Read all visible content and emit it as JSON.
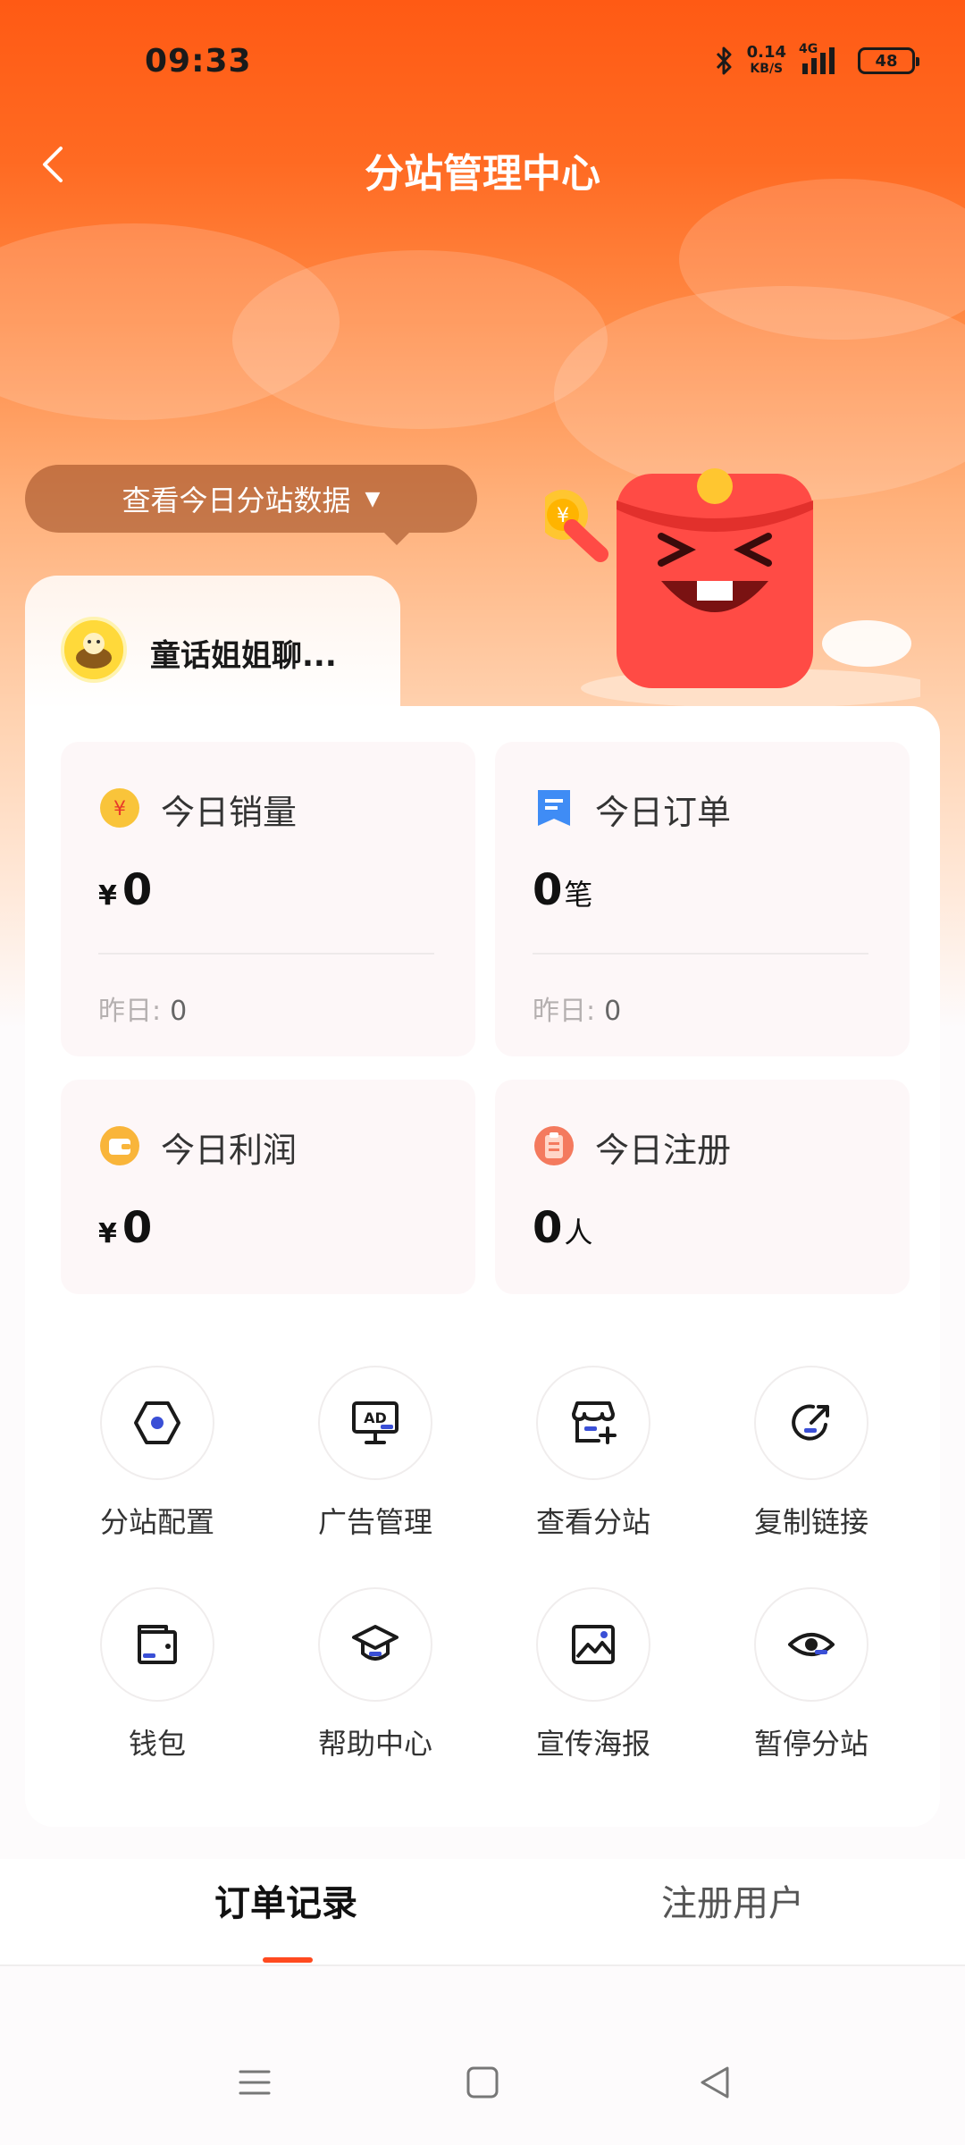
{
  "status_bar": {
    "time": "09:33",
    "net_speed_value": "0.14",
    "net_speed_unit": "KB/S",
    "network": "4G",
    "battery": "48"
  },
  "header": {
    "title": "分站管理中心"
  },
  "data_toggle": {
    "label": "查看今日分站数据",
    "arrow": "▼"
  },
  "profile": {
    "name": "童话姐姐聊..."
  },
  "stats": [
    {
      "label": "今日销量",
      "currency": "¥",
      "value": "0",
      "unit": "",
      "yesterday_label": "昨日:",
      "yesterday_value": "0",
      "icon": "coin-icon",
      "color": "#f9c43a"
    },
    {
      "label": "今日订单",
      "currency": "",
      "value": "0",
      "unit": "笔",
      "yesterday_label": "昨日:",
      "yesterday_value": "0",
      "icon": "order-icon",
      "color": "#3f8cf5"
    },
    {
      "label": "今日利润",
      "currency": "¥",
      "value": "0",
      "unit": "",
      "icon": "wallet-icon",
      "color": "#f9b53a"
    },
    {
      "label": "今日注册",
      "currency": "",
      "value": "0",
      "unit": "人",
      "icon": "clipboard-icon",
      "color": "#f47a5e"
    }
  ],
  "tools": [
    {
      "label": "分站配置",
      "icon": "settings-hex-icon"
    },
    {
      "label": "广告管理",
      "icon": "ad-board-icon"
    },
    {
      "label": "查看分站",
      "icon": "store-icon"
    },
    {
      "label": "复制链接",
      "icon": "share-link-icon"
    },
    {
      "label": "钱包",
      "icon": "wallet-outline-icon"
    },
    {
      "label": "帮助中心",
      "icon": "graduation-cap-icon"
    },
    {
      "label": "宣传海报",
      "icon": "poster-image-icon"
    },
    {
      "label": "暂停分站",
      "icon": "eye-icon"
    }
  ],
  "tabs": [
    {
      "label": "订单记录",
      "active": true
    },
    {
      "label": "注册用户",
      "active": false
    }
  ],
  "colors": {
    "brand_orange": "#ff5a14",
    "accent_blue": "#3a4fd6",
    "tab_indicator": "#ff4a1f"
  }
}
